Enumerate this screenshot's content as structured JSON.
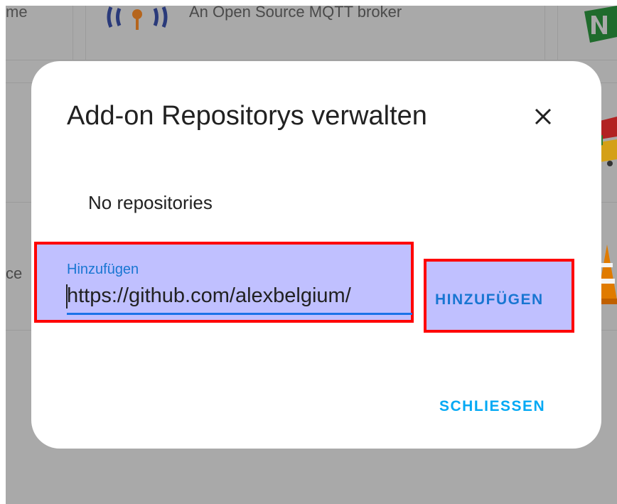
{
  "background": {
    "card_left_text": "me",
    "card_mqtt_text": "An Open Source MQTT broker",
    "card_left_text_2": "ce"
  },
  "dialog": {
    "title": "Add-on Repositorys verwalten",
    "close_icon": "close-icon",
    "empty_message": "No repositories",
    "input": {
      "label": "Hinzufügen",
      "value": "https://github.com/alexbelgium/"
    },
    "add_button_label": "HINZUFÜGEN",
    "close_button_label": "SCHLIESSEN"
  },
  "colors": {
    "accent": "#1976d2",
    "secondary_action": "#03a9f4",
    "highlight_fill": "#c0c0ff",
    "highlight_border": "#ff0000",
    "backdrop": "#a9a9a9"
  }
}
